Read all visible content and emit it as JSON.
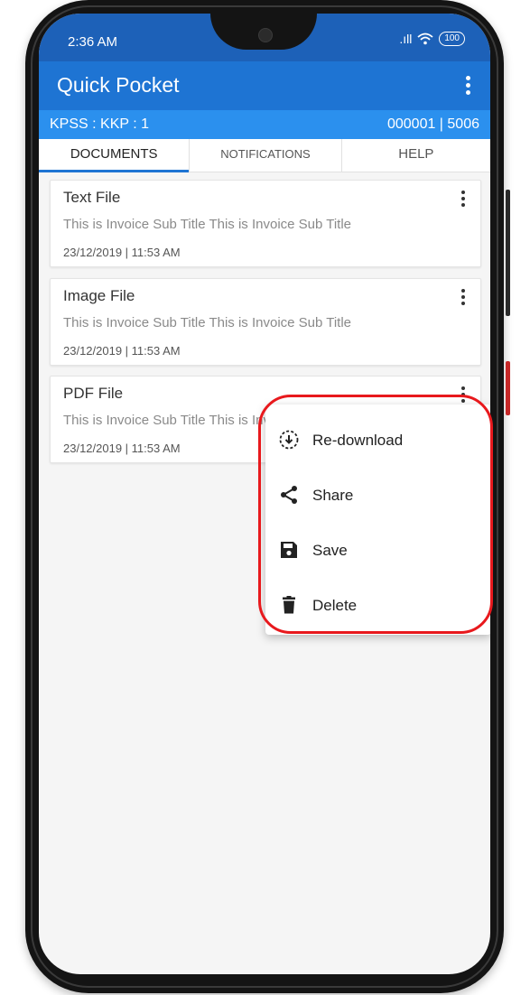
{
  "status_bar": {
    "time": "2:36 AM",
    "signal": ".ıll",
    "wifi": "wifi-icon",
    "battery": "100"
  },
  "app_bar": {
    "title": "Quick Pocket",
    "menu_icon": "more-vert-icon"
  },
  "info_bar": {
    "left": "KPSS : KKP : 1",
    "right": "000001 | 5006"
  },
  "tabs": [
    {
      "label": "DOCUMENTS",
      "active": true
    },
    {
      "label": "NOTIFICATIONS",
      "active": false
    },
    {
      "label": "HELP",
      "active": false
    }
  ],
  "documents": [
    {
      "title": "Text File",
      "subtitle": "This is Invoice Sub Title This is Invoice Sub Title",
      "date": "23/12/2019 | 11:53 AM"
    },
    {
      "title": "Image File",
      "subtitle": "This is Invoice Sub Title This is Invoice Sub Title",
      "date": "23/12/2019 | 11:53 AM"
    },
    {
      "title": "PDF File",
      "subtitle": "This is Invoice Sub Title This is Invoice Sub Title",
      "date": "23/12/2019 | 11:53 AM"
    }
  ],
  "context_menu": {
    "items": [
      {
        "label": "Re-download",
        "icon": "download-circle-icon"
      },
      {
        "label": "Share",
        "icon": "share-icon"
      },
      {
        "label": "Save",
        "icon": "save-icon"
      },
      {
        "label": "Delete",
        "icon": "delete-icon"
      }
    ]
  },
  "colors": {
    "primary": "#1e74d3",
    "status_bar": "#1d61b8",
    "info_bar": "#2b90ee",
    "highlight": "#e8191d"
  }
}
